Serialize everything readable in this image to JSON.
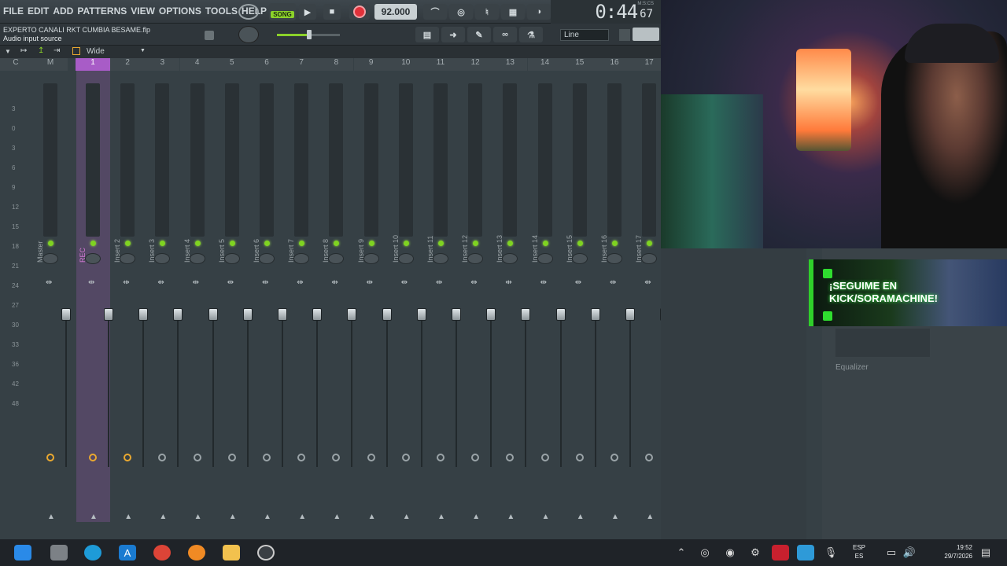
{
  "menu": [
    "FILE",
    "EDIT",
    "ADD",
    "PATTERNS",
    "VIEW",
    "OPTIONS",
    "TOOLS",
    "HELP"
  ],
  "transport": {
    "song_label": "SONG",
    "tempo": "92.000",
    "play": "▶",
    "stop": "■",
    "rec": ""
  },
  "toolbar_icons": [
    "metronome",
    "wait",
    "countdown",
    "step",
    "loop"
  ],
  "clock": {
    "time": "0:44",
    "cs": "67",
    "label": "M:S:CS"
  },
  "project": {
    "title": "EXPERTO CANALI RKT CUMBIA BESAME.flp",
    "hint": "Audio input source"
  },
  "snap": {
    "value": "Line"
  },
  "mixer": {
    "view_label": "Wide",
    "header_nums": [
      "C",
      "M",
      "1",
      "2",
      "3",
      "4",
      "5",
      "6",
      "7",
      "8",
      "9",
      "10",
      "11",
      "12",
      "13",
      "14",
      "15",
      "16",
      "17"
    ],
    "strip_names": [
      "Master",
      "REC",
      "Insert 2",
      "Insert 3",
      "Insert 4",
      "Insert 5",
      "Insert 6",
      "Insert 7",
      "Insert 8",
      "Insert 9",
      "Insert 10",
      "Insert 11",
      "Insert 12",
      "Insert 13",
      "Insert 14",
      "Insert 15",
      "Insert 16",
      "Insert 17"
    ],
    "scale": [
      "3",
      "0",
      "3",
      "6",
      "9",
      "12",
      "15",
      "18",
      "21",
      "24",
      "27",
      "30",
      "33",
      "36",
      "42",
      "48"
    ]
  },
  "banner": {
    "line1": "¡SEGUIME EN",
    "line2": "KICK/SORAMACHINE!"
  },
  "side_panel": {
    "equalizer": "Equalizer"
  },
  "taskbar": {
    "lang1": "ESP",
    "lang2": "ES",
    "time": "19:52",
    "date": "29/7/2026"
  },
  "colors": {
    "accent": "#8bd12a",
    "selected": "#a85cc7",
    "rec": "#e2313a"
  }
}
